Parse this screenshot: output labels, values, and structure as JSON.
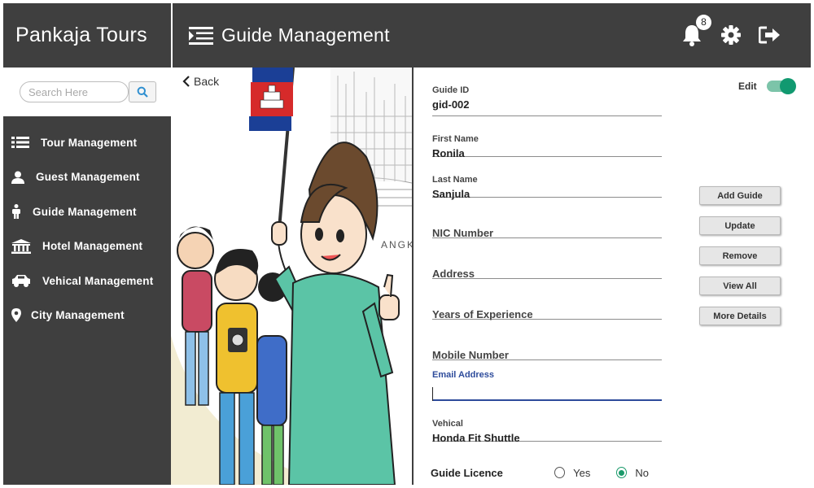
{
  "app": {
    "brand": "Pankaja Tours",
    "page_title": "Guide Management",
    "notification_count": "8",
    "accent_color": "#119970",
    "dark_color": "#3f3f3f"
  },
  "sidebar": {
    "search_placeholder": "Search Here",
    "items": [
      {
        "label": "Tour Management",
        "icon": "list-icon"
      },
      {
        "label": "Guest Management",
        "icon": "user-icon"
      },
      {
        "label": "Guide Management",
        "icon": "person-icon"
      },
      {
        "label": "Hotel Management",
        "icon": "bank-icon"
      },
      {
        "label": "Vehical Management",
        "icon": "car-icon"
      },
      {
        "label": "City Management",
        "icon": "map-marker-icon"
      }
    ]
  },
  "content": {
    "back_label": "Back",
    "edit_label": "Edit",
    "edit_enabled": true
  },
  "form": {
    "guide_id": {
      "label": "Guide ID",
      "value": "gid-002"
    },
    "first_name": {
      "label": "First Name",
      "value": "Ronila"
    },
    "last_name": {
      "label": "Last Name",
      "value": "Sanjula"
    },
    "nic": {
      "placeholder": "NIC Number"
    },
    "address": {
      "placeholder": "Address"
    },
    "experience": {
      "placeholder": "Years of Experience"
    },
    "mobile": {
      "placeholder": "Mobile Number"
    },
    "email": {
      "label": "Email Address",
      "value": ""
    },
    "vehical": {
      "label": "Vehical",
      "value": "Honda Fit Shuttle"
    },
    "licence": {
      "label": "Guide Licence",
      "yes": "Yes",
      "no": "No",
      "selected": "No"
    }
  },
  "actions": {
    "add": "Add Guide",
    "update": "Update",
    "remove": "Remove",
    "view_all": "View All",
    "more_details": "More Details"
  }
}
